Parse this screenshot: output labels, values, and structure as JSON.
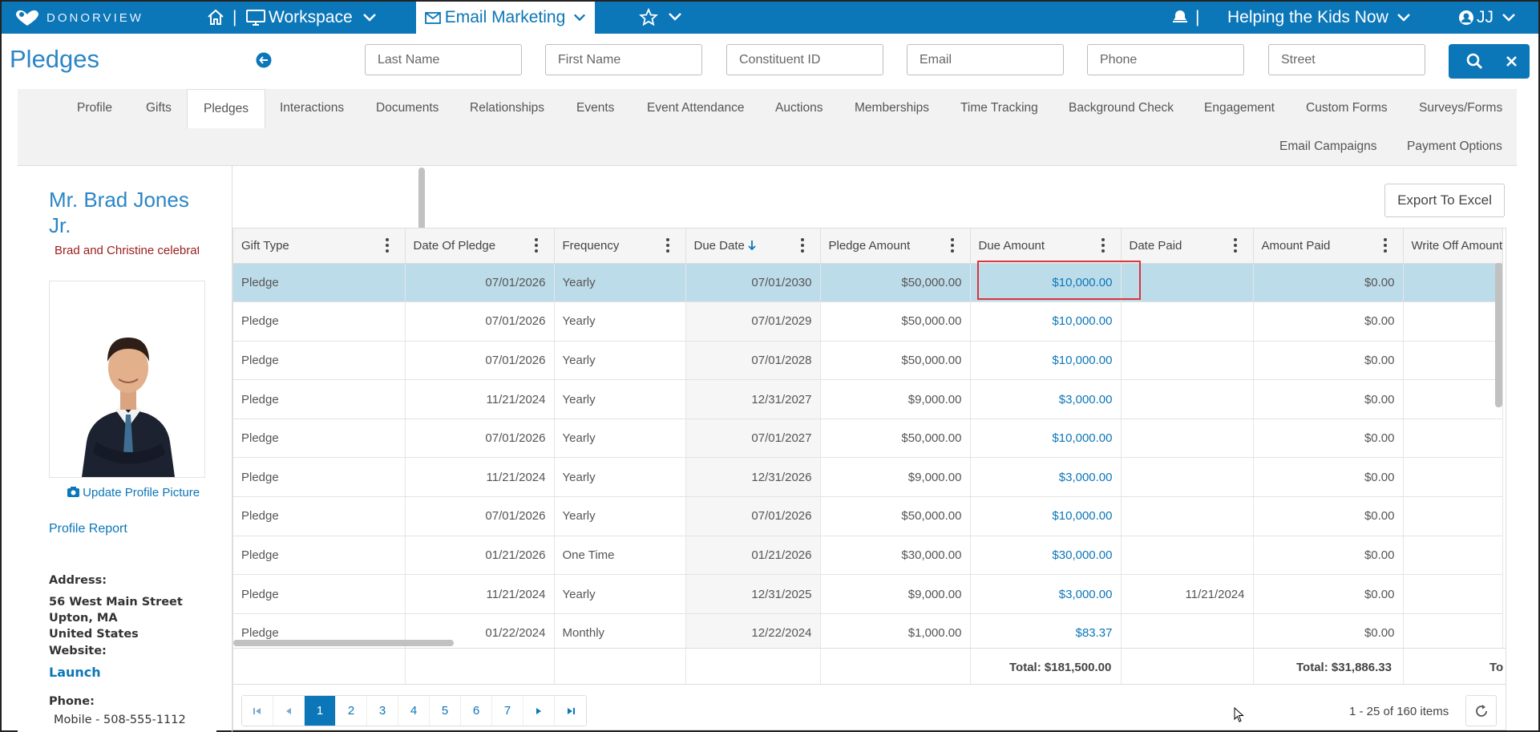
{
  "topbar": {
    "brand": "DONORVIEW",
    "sep1": "|",
    "workspace": "Workspace",
    "email_marketing": "Email Marketing",
    "sep2": "|",
    "org": "Helping the Kids Now",
    "user": "JJ"
  },
  "page_title": "Pledges",
  "search": {
    "last_name": "Last Name",
    "first_name": "First Name",
    "constituent_id": "Constituent ID",
    "email": "Email",
    "phone": "Phone",
    "street": "Street"
  },
  "tabs": [
    "Profile",
    "Gifts",
    "Pledges",
    "Interactions",
    "Documents",
    "Relationships",
    "Events",
    "Event Attendance",
    "Auctions",
    "Memberships",
    "Time Tracking",
    "Background Check",
    "Engagement",
    "Custom Forms",
    "Surveys/Forms",
    "Email Campaigns",
    "Payment Options"
  ],
  "profile": {
    "name": "Mr. Brad Jones Jr.",
    "note": "Brad and Christine celebrate",
    "update_picture": "Update Profile Picture",
    "profile_report": "Profile Report",
    "address_label": "Address:",
    "address_line1": "56 West Main Street",
    "address_line2": "Upton, MA",
    "address_line3": "United States",
    "website_label": "Website:",
    "website_link": "Launch",
    "phone_label": "Phone:",
    "mobile": "Mobile -   508-555-1112"
  },
  "export_label": "Export To Excel",
  "grid": {
    "columns": [
      "Gift Type",
      "Date Of Pledge",
      "Frequency",
      "Due Date",
      "Pledge Amount",
      "Due Amount",
      "Date Paid",
      "Amount Paid",
      "Write Off Amount"
    ],
    "rows": [
      [
        "Pledge",
        "07/01/2026",
        "Yearly",
        "07/01/2030",
        "$50,000.00",
        "$10,000.00",
        "",
        "$0.00",
        ""
      ],
      [
        "Pledge",
        "07/01/2026",
        "Yearly",
        "07/01/2029",
        "$50,000.00",
        "$10,000.00",
        "",
        "$0.00",
        ""
      ],
      [
        "Pledge",
        "07/01/2026",
        "Yearly",
        "07/01/2028",
        "$50,000.00",
        "$10,000.00",
        "",
        "$0.00",
        ""
      ],
      [
        "Pledge",
        "11/21/2024",
        "Yearly",
        "12/31/2027",
        "$9,000.00",
        "$3,000.00",
        "",
        "$0.00",
        ""
      ],
      [
        "Pledge",
        "07/01/2026",
        "Yearly",
        "07/01/2027",
        "$50,000.00",
        "$10,000.00",
        "",
        "$0.00",
        ""
      ],
      [
        "Pledge",
        "11/21/2024",
        "Yearly",
        "12/31/2026",
        "$9,000.00",
        "$3,000.00",
        "",
        "$0.00",
        ""
      ],
      [
        "Pledge",
        "07/01/2026",
        "Yearly",
        "07/01/2026",
        "$50,000.00",
        "$10,000.00",
        "",
        "$0.00",
        ""
      ],
      [
        "Pledge",
        "01/21/2026",
        "One Time",
        "01/21/2026",
        "$30,000.00",
        "$30,000.00",
        "",
        "$0.00",
        ""
      ],
      [
        "Pledge",
        "11/21/2024",
        "Yearly",
        "12/31/2025",
        "$9,000.00",
        "$3,000.00",
        "11/21/2024",
        "$0.00",
        ""
      ],
      [
        "Pledge",
        "01/22/2024",
        "Monthly",
        "12/22/2024",
        "$1,000.00",
        "$83.37",
        "",
        "$0.00",
        ""
      ]
    ],
    "selected_row": 0,
    "total_due": "Total: $181,500.00",
    "total_paid": "Total: $31,886.33",
    "total_writeoff": "To"
  },
  "pager": {
    "pages": [
      "1",
      "2",
      "3",
      "4",
      "5",
      "6",
      "7"
    ],
    "current": "1",
    "info": "1 - 25 of 160 items"
  },
  "colors": {
    "primary": "#0b76b8",
    "selected_row": "#bddcea",
    "highlight": "#d9363e"
  }
}
